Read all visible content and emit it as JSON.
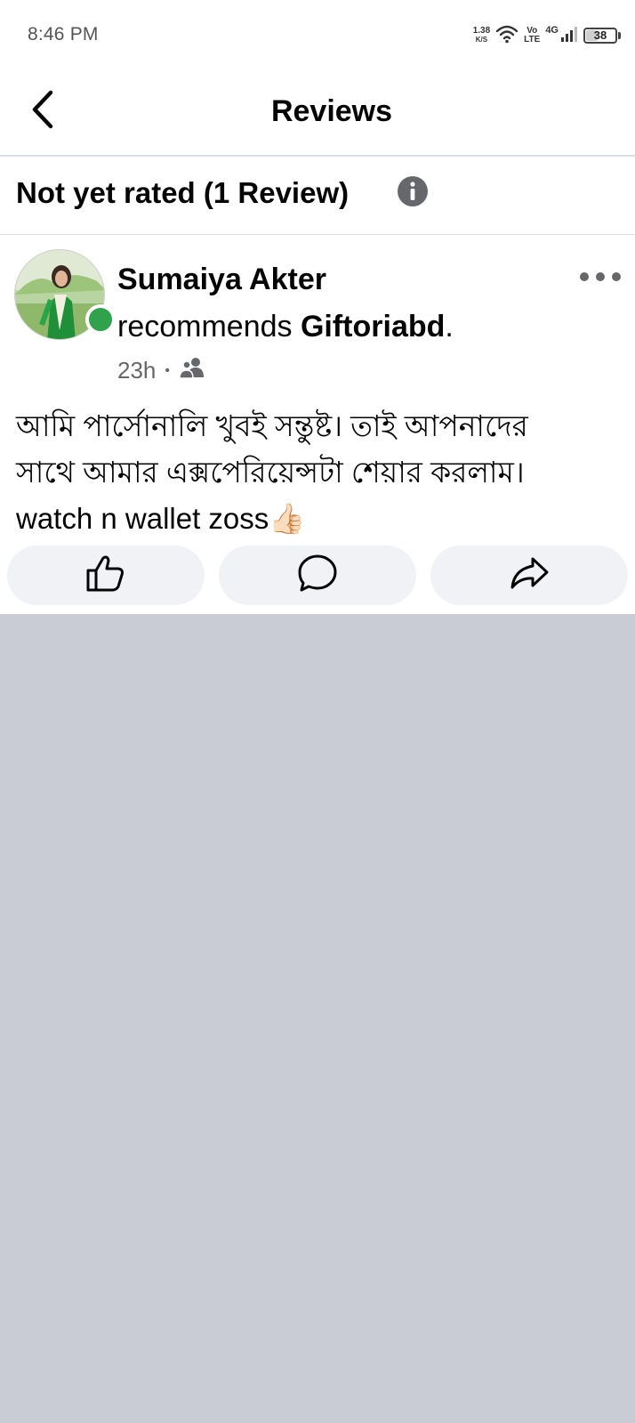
{
  "status_bar": {
    "time": "8:46 PM",
    "net_speed_value": "1.38",
    "net_speed_unit": "K/S",
    "volte_top": "Vo",
    "volte_bottom": "LTE",
    "network_gen": "4G",
    "battery_level": "38",
    "icons": [
      "wifi-icon",
      "signal-icon",
      "battery-icon"
    ]
  },
  "header": {
    "title": "Reviews",
    "back_icon": "chevron-left-icon"
  },
  "rating": {
    "summary": "Not yet rated (1 Review)",
    "info_icon": "info-icon"
  },
  "review": {
    "author": "Sumaiya Akter",
    "action": "recommends",
    "page_name": "Giftoriabd",
    "page_suffix": ".",
    "time_ago": "23h",
    "separator": "•",
    "audience_icon": "friends-icon",
    "online": true,
    "body_line1": "আমি পার্সোনালি খুবই সন্তুষ্ট। তাই আপনাদের",
    "body_line2": "সাথে আমার এক্সপেরিয়েন্সটা শেয়ার করলাম।",
    "body_line3": "watch n wallet zoss",
    "body_emoji": "👍🏻"
  },
  "actions": {
    "like_icon": "thumbs-up-icon",
    "comment_icon": "comment-icon",
    "share_icon": "share-icon"
  },
  "colors": {
    "online": "#31a24c",
    "secondary_text": "#65676b",
    "button_bg": "#f0f2f5",
    "empty_area": "#c9ccd5"
  }
}
